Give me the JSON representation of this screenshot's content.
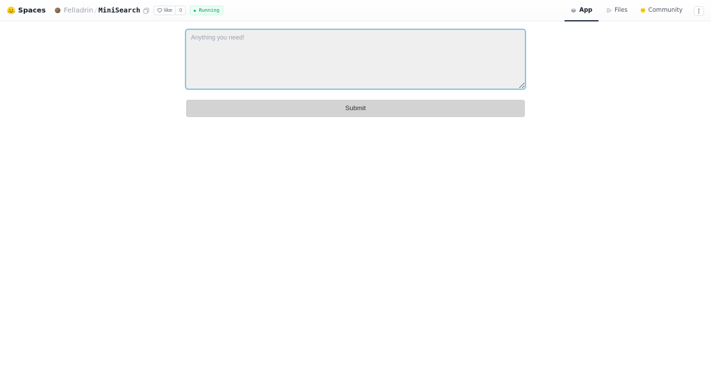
{
  "header": {
    "brand": {
      "label": "Spaces",
      "icon": "hugging-face-icon"
    },
    "breadcrumb": {
      "owner": "Felladrin",
      "separator": "/",
      "repo": "MiniSearch"
    },
    "like": {
      "label": "like",
      "count": "0"
    },
    "status": {
      "label": "Running",
      "color": "#059669"
    },
    "tabs": [
      {
        "label": "App",
        "icon": "app-icon",
        "active": true
      },
      {
        "label": "Files",
        "icon": "files-icon",
        "active": false
      },
      {
        "label": "Community",
        "icon": "community-icon",
        "active": false
      }
    ],
    "more_icon": "more-vertical-icon"
  },
  "main": {
    "query": {
      "value": "",
      "placeholder": "Anything you need!"
    },
    "submit_label": "Submit"
  },
  "colors": {
    "input_border": "#6fb5dc",
    "input_bg": "#efefef",
    "button_bg": "#d3d3d3",
    "status_green": "#059669"
  }
}
